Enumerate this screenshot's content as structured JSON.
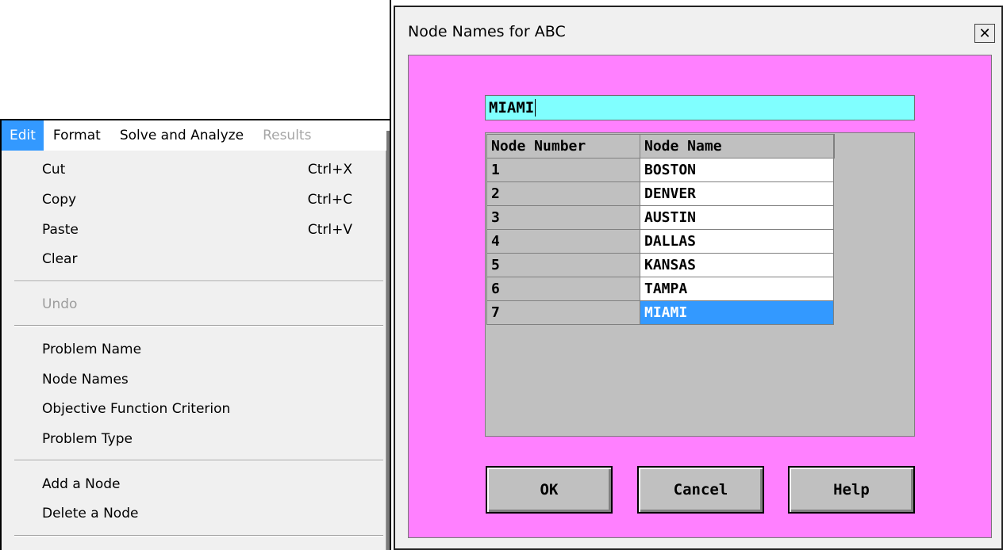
{
  "menu": {
    "bar": [
      {
        "label": "Edit",
        "state": "active"
      },
      {
        "label": "Format",
        "state": "normal"
      },
      {
        "label": "Solve and Analyze",
        "state": "normal"
      },
      {
        "label": "Results",
        "state": "disabled"
      }
    ],
    "items": {
      "cut": {
        "label": "Cut",
        "shortcut": "Ctrl+X"
      },
      "copy": {
        "label": "Copy",
        "shortcut": "Ctrl+C"
      },
      "paste": {
        "label": "Paste",
        "shortcut": "Ctrl+V"
      },
      "clear": {
        "label": "Clear"
      },
      "undo": {
        "label": "Undo"
      },
      "problem_name": {
        "label": "Problem Name"
      },
      "node_names": {
        "label": "Node Names"
      },
      "objective": {
        "label": "Objective Function Criterion"
      },
      "problem_type": {
        "label": "Problem Type"
      },
      "add_node": {
        "label": "Add a Node"
      },
      "delete_node": {
        "label": "Delete a Node"
      }
    }
  },
  "dialog": {
    "title": "Node Names for ABC",
    "close_glyph": "✕",
    "edit_value": "MIAMI",
    "columns": {
      "number": "Node Number",
      "name": "Node Name"
    },
    "rows": [
      {
        "number": "1",
        "name": "BOSTON"
      },
      {
        "number": "2",
        "name": "DENVER"
      },
      {
        "number": "3",
        "name": "AUSTIN"
      },
      {
        "number": "4",
        "name": "DALLAS"
      },
      {
        "number": "5",
        "name": "KANSAS"
      },
      {
        "number": "6",
        "name": "TAMPA"
      },
      {
        "number": "7",
        "name": "MIAMI"
      }
    ],
    "selected_row": 6,
    "buttons": {
      "ok": "OK",
      "cancel": "Cancel",
      "help": "Help"
    },
    "colors": {
      "client_bg": "#ff80ff",
      "edit_bg": "#80ffff",
      "selection": "#3399ff"
    }
  }
}
